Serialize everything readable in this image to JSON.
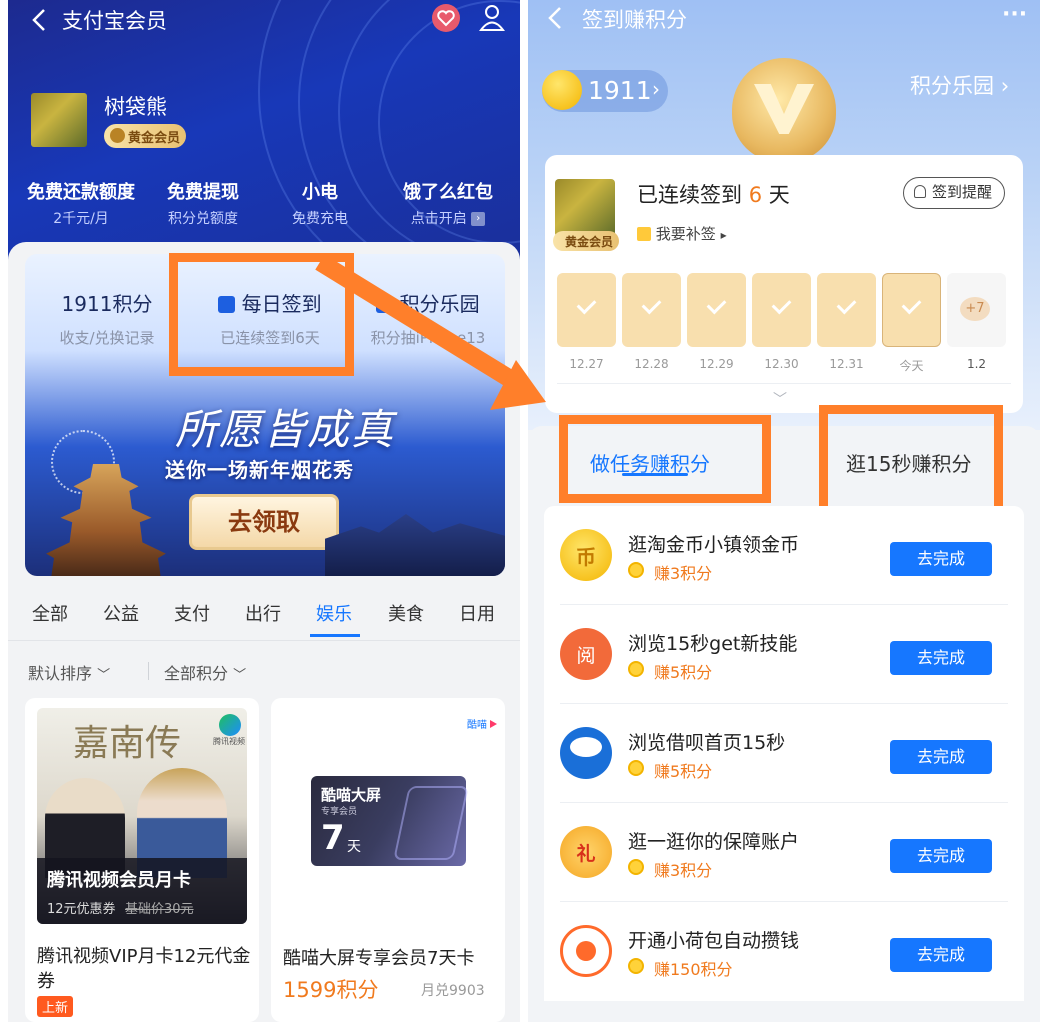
{
  "left": {
    "nav_title": "支付宝会员",
    "user": {
      "name": "树袋熊",
      "badge": "黄金会员"
    },
    "benefits": [
      {
        "title": "免费还款额度",
        "sub": "2千元/月"
      },
      {
        "title": "免费提现",
        "sub": "积分兑额度"
      },
      {
        "title": "小电",
        "sub": "免费充电"
      },
      {
        "title": "饿了么红包",
        "sub": "点击开启"
      }
    ],
    "stats": [
      {
        "title": "1911积分",
        "sub": "收支/兑换记录"
      },
      {
        "title": "每日签到",
        "sub": "已连续签到6天"
      },
      {
        "title": "积分乐园",
        "sub": "积分抽iPhone13"
      }
    ],
    "banner": {
      "headline": "所愿皆成真",
      "sub": "送你一场新年烟花秀",
      "button": "去领取"
    },
    "categories": [
      "全部",
      "公益",
      "支付",
      "出行",
      "娱乐",
      "美食",
      "日用"
    ],
    "active_category": "娱乐",
    "filters": [
      "默认排序",
      "全部积分"
    ],
    "products": [
      {
        "poster_title": "嘉南传",
        "brand": "腾讯视频",
        "overlay_title": "腾讯视频会员月卡",
        "overlay_coupon": "12元优惠券",
        "overlay_base": "基础价30元",
        "name": "腾讯视频VIP月卡12元代金券",
        "tag": "上新"
      },
      {
        "brand": "酷喵",
        "card_title": "酷喵大屏",
        "card_sub": "专享会员",
        "card_days": "7",
        "card_unit": "天",
        "name": "酷喵大屏专享会员7天卡",
        "points": "1599积分",
        "redeemed": "月兑9903"
      }
    ]
  },
  "right": {
    "nav_title": "签到赚积分",
    "more": "···",
    "points": "1911",
    "park": "积分乐园",
    "streak_prefix": "已连续签到",
    "streak_days": "6",
    "streak_suffix": "天",
    "badge": "黄金会员",
    "makeup": "我要补签",
    "reminder": "签到提醒",
    "days": [
      {
        "label": "12.27",
        "state": "done"
      },
      {
        "label": "12.28",
        "state": "done"
      },
      {
        "label": "12.29",
        "state": "done"
      },
      {
        "label": "12.30",
        "state": "done"
      },
      {
        "label": "12.31",
        "state": "done"
      },
      {
        "label": "今天",
        "state": "today"
      },
      {
        "label": "1.2",
        "state": "future",
        "bonus": "+7"
      }
    ],
    "tabs": [
      "做任务赚积分",
      "逛15秒赚积分"
    ],
    "tasks": [
      {
        "title": "逛淘金币小镇领金币",
        "points": "赚3积分",
        "button": "去完成",
        "icon_color": "#f7b500",
        "icon_glyph": "币"
      },
      {
        "title": "浏览15秒get新技能",
        "points": "赚5积分",
        "button": "去完成",
        "icon_color": "#f26a3a",
        "icon_glyph": "阅"
      },
      {
        "title": "浏览借呗首页15秒",
        "points": "赚5积分",
        "button": "去完成",
        "icon_color": "#1a6fd8",
        "icon_glyph": ""
      },
      {
        "title": "逛一逛你的保障账户",
        "points": "赚3积分",
        "button": "去完成",
        "icon_color": "#f5a623",
        "icon_glyph": "礼"
      },
      {
        "title": "开通小荷包自动攒钱",
        "points": "赚150积分",
        "button": "去完成",
        "icon_color": "#ff6a2b",
        "icon_glyph": ""
      }
    ]
  }
}
